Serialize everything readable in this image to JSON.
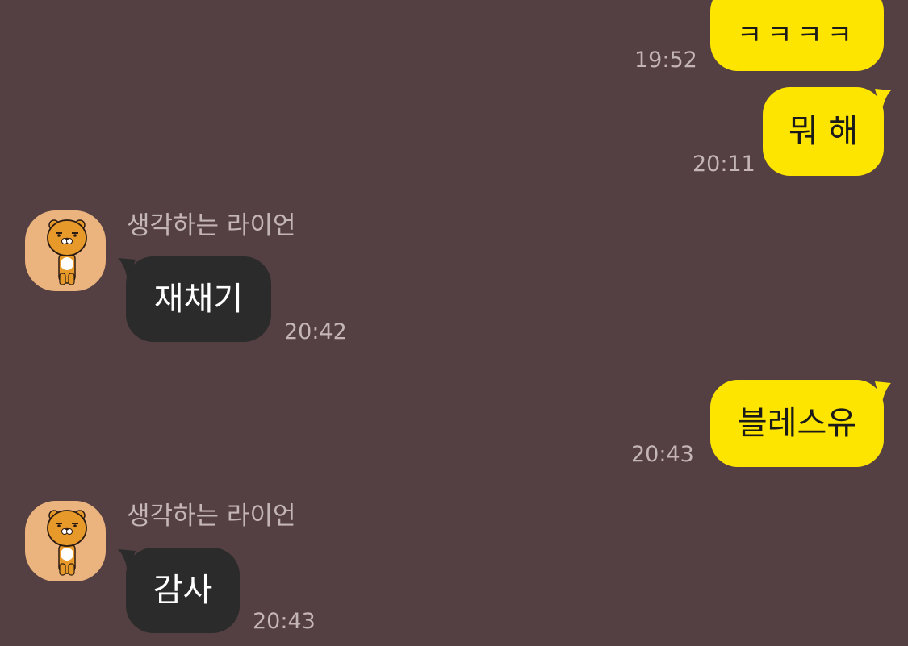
{
  "messages": [
    {
      "side": "mine",
      "text": "ㅋㅋㅋㅋ",
      "time": "19:52"
    },
    {
      "side": "mine",
      "text": "뭐 해",
      "time": "20:11"
    },
    {
      "side": "theirs",
      "sender": "생각하는 라이언",
      "avatar_icon": "ryan-avatar-icon",
      "text": "재채기",
      "time": "20:42"
    },
    {
      "side": "mine",
      "text": "블레스유",
      "time": "20:43"
    },
    {
      "side": "theirs",
      "sender": "생각하는 라이언",
      "avatar_icon": "ryan-avatar-icon",
      "text": "감사",
      "time": "20:43"
    }
  ],
  "colors": {
    "background": "#544042",
    "my_bubble": "#FEE500",
    "their_bubble": "#2B2B2B",
    "timestamp": "#C4B5B6",
    "avatar_bg": "#EBB47F"
  }
}
